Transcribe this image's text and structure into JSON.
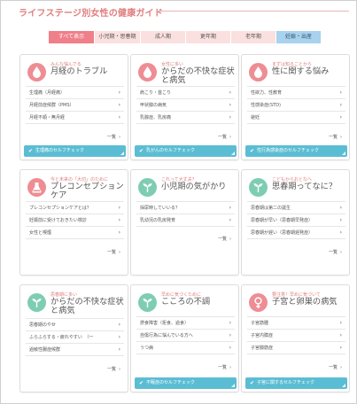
{
  "title": "ライフステージ別女性の健康ガイド",
  "tabs": [
    "すべて表示",
    "小児期・思春期",
    "成人期",
    "更年期",
    "老年期",
    "妊娠・出産"
  ],
  "more_label": "一覧",
  "cards": [
    {
      "subtitle": "みんな悩んでる",
      "title": "月経のトラブル",
      "icon": "droplet-icon",
      "items": [
        "生理痛（月経痛）",
        "月経前症候群（PMS）",
        "月経不順・無月経"
      ],
      "check": "生理痛のセルフチェック"
    },
    {
      "subtitle": "女性に多い",
      "title": "からだの不快な症状と病気",
      "icon": "droplet-icon",
      "items": [
        "肩こり・首こり",
        "甲状腺の病気",
        "乳腺症、乳房痛"
      ],
      "check": "乳がんのセルフチェック"
    },
    {
      "subtitle": "まずは知ることから",
      "title": "性に関する悩み",
      "icon": "droplet-icon",
      "items": [
        "性欲力、性教育",
        "性感染症(STD)",
        "避妊"
      ],
      "check": "性行為感染症のセルフチェック"
    },
    {
      "subtitle": "今と未来の「大切」のために",
      "title": "プレコンセプションケア",
      "icon": "flask-icon",
      "items": [
        "プレコンセプションケアとは？",
        "妊娠前に受けておきたい検診",
        "女性と喫煙"
      ],
      "check": ""
    },
    {
      "subtitle": "これって大丈夫？",
      "title": "小児期の気がかり",
      "icon": "sprout-icon",
      "items": [
        "採尿時していいる？",
        "乳幼児の乳房発育"
      ],
      "check": ""
    },
    {
      "subtitle": "こどもからおとなへ",
      "title": "思春期ってなに？",
      "icon": "sprout-icon",
      "items": [
        "思春期は第二の誕生",
        "思春期が早い（思春期早発症）",
        "思春期が遅い（思春期遅発症）"
      ],
      "check": ""
    },
    {
      "subtitle": "思春期に多い",
      "title": "からだの不快な症状と病気",
      "icon": "sprout-icon",
      "items": [
        "思春期のやせ",
        "ふらふらする・疲れやすい　（一",
        "過敏性腸症候群"
      ],
      "check": ""
    },
    {
      "subtitle": "早めに気づくために",
      "title": "こころの不調",
      "icon": "sprout-icon",
      "items": [
        "摂食障害（拒食、過食）",
        "自傷行為に悩んでいる方へ",
        "うつ病"
      ],
      "check": "不眠症のセルフチェック"
    },
    {
      "subtitle": "要注意！早めに気づいて",
      "title": "子宮と卵巣の病気",
      "icon": "female-symbol-icon",
      "items": [
        "子宮筋腫",
        "子宮内膜症",
        "子宮腺筋症"
      ],
      "check": "子宮に関するセルフチェック"
    }
  ]
}
